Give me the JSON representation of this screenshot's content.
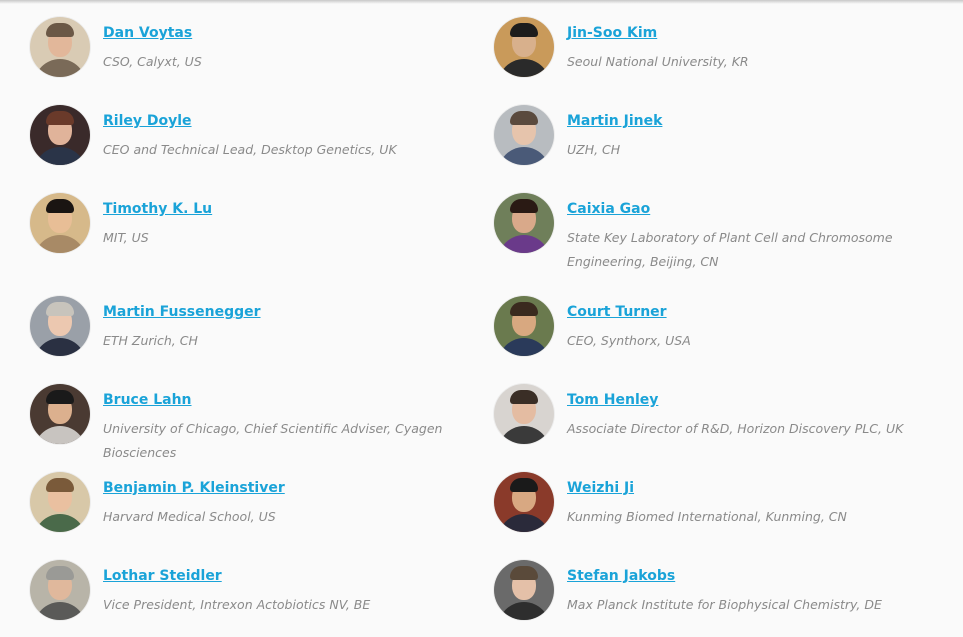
{
  "speakers": [
    {
      "name": "Dan Voytas",
      "role": "CSO, Calyxt, US",
      "colors": {
        "bg": "#d9cbb4",
        "skin": "#e2b79a",
        "hair": "#6b5846",
        "shirt": "#7a6a58"
      }
    },
    {
      "name": "Jin-Soo Kim",
      "role": "Seoul National University, KR",
      "colors": {
        "bg": "#c99a5a",
        "skin": "#d8b08c",
        "hair": "#1c1c1c",
        "shirt": "#2a2a2a"
      }
    },
    {
      "name": "Riley Doyle",
      "role": "CEO and Technical Lead, Desktop Genetics, UK",
      "colors": {
        "bg": "#3a2a2a",
        "skin": "#e0b39a",
        "hair": "#6a3a2a",
        "shirt": "#2a3448"
      }
    },
    {
      "name": "Martin Jinek",
      "role": "UZH, CH",
      "colors": {
        "bg": "#b8bcc0",
        "skin": "#e6c4ac",
        "hair": "#5a4a3e",
        "shirt": "#4a5a78"
      }
    },
    {
      "name": "Timothy K. Lu",
      "role": "MIT, US",
      "colors": {
        "bg": "#d6b98a",
        "skin": "#e8be96",
        "hair": "#1a1512",
        "shirt": "#a88a66"
      }
    },
    {
      "name": "Caixia Gao",
      "role": "State Key Laboratory of Plant Cell and Chromosome Engineering, Beijing, CN",
      "colors": {
        "bg": "#6f7f5a",
        "skin": "#d9a98a",
        "hair": "#2a1a14",
        "shirt": "#6a3a8a"
      }
    },
    {
      "name": "Martin Fussenegger",
      "role": "ETH Zurich, CH",
      "colors": {
        "bg": "#9aa0a8",
        "skin": "#ecc8b0",
        "hair": "#c8c4bc",
        "shirt": "#2a3042"
      }
    },
    {
      "name": "Court Turner",
      "role": "CEO, Synthorx, USA",
      "colors": {
        "bg": "#6a7a4e",
        "skin": "#d8a880",
        "hair": "#3a2a1e",
        "shirt": "#2a3a5a"
      }
    },
    {
      "name": "Bruce Lahn",
      "role": "University of Chicago, Chief Scientific Adviser, Cyagen Biosciences",
      "colors": {
        "bg": "#4a3a32",
        "skin": "#dcb08e",
        "hair": "#1a1a1a",
        "shirt": "#c8c4c0"
      }
    },
    {
      "name": "Tom Henley",
      "role": "Associate Director of R&D, Horizon Discovery PLC, UK",
      "colors": {
        "bg": "#d8d4d0",
        "skin": "#e4bca2",
        "hair": "#3a2e26",
        "shirt": "#3a3a3a"
      }
    },
    {
      "name": "Benjamin P. Kleinstiver",
      "role": "Harvard Medical School, US",
      "colors": {
        "bg": "#d8c8a8",
        "skin": "#eac0a0",
        "hair": "#7a5a3a",
        "shirt": "#4a6a4a"
      }
    },
    {
      "name": "Weizhi Ji",
      "role": "Kunming Biomed International, Kunming, CN",
      "colors": {
        "bg": "#8a3a2a",
        "skin": "#d8a882",
        "hair": "#1a1a1a",
        "shirt": "#2a2a3a"
      }
    },
    {
      "name": "Lothar Steidler",
      "role": "Vice President, Intrexon Actobiotics NV, BE",
      "colors": {
        "bg": "#b8b4a8",
        "skin": "#e0b89c",
        "hair": "#9a9a96",
        "shirt": "#5a5a58"
      }
    },
    {
      "name": "Stefan Jakobs",
      "role": "Max Planck Institute for Biophysical Chemistry, DE",
      "colors": {
        "bg": "#6a6a6a",
        "skin": "#e4c0a8",
        "hair": "#5a4a3a",
        "shirt": "#2e2e2e"
      }
    }
  ]
}
